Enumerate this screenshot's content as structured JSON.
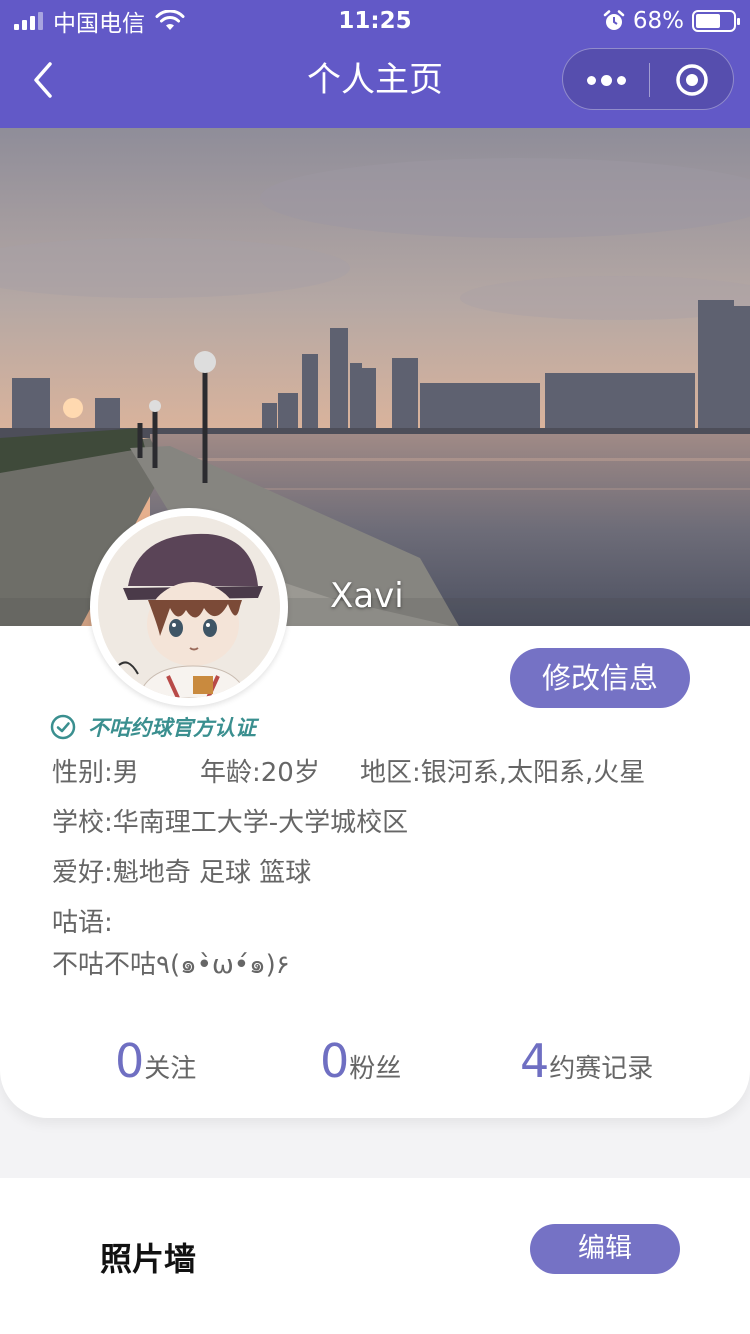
{
  "status_bar": {
    "carrier": "中国电信",
    "time": "11:25",
    "battery_percent": "68%",
    "battery_level": 0.68,
    "icons": [
      "signal-icon",
      "wifi-icon",
      "alarm-icon",
      "battery-icon"
    ]
  },
  "nav": {
    "title": "个人主页",
    "icons": [
      "back-icon",
      "more-icon",
      "close-capsule-icon"
    ]
  },
  "profile": {
    "username": "Xavi",
    "edit_button": "修改信息",
    "verified_label": "不咕约球官方认证",
    "gender": "性别:男",
    "age": "年龄:20岁",
    "region": "地区:银河系,太阳系,火星",
    "school": "学校:华南理工大学-大学城校区",
    "hobbies": "爱好:魁地奇 足球 篮球",
    "motto_label": "咕语:",
    "motto": "不咕不咕٩(๑•̀ω•́๑)۶"
  },
  "stats": [
    {
      "num": "0",
      "label": "关注"
    },
    {
      "num": "0",
      "label": "粉丝"
    },
    {
      "num": "4",
      "label": "约赛记录"
    }
  ],
  "photo_wall": {
    "title": "照片墙",
    "edit_button": "编辑"
  },
  "colors": {
    "primary": "#6259c7",
    "button": "#7572c5",
    "stat_number": "#6f6fc2",
    "verified": "#3a8f8f"
  }
}
